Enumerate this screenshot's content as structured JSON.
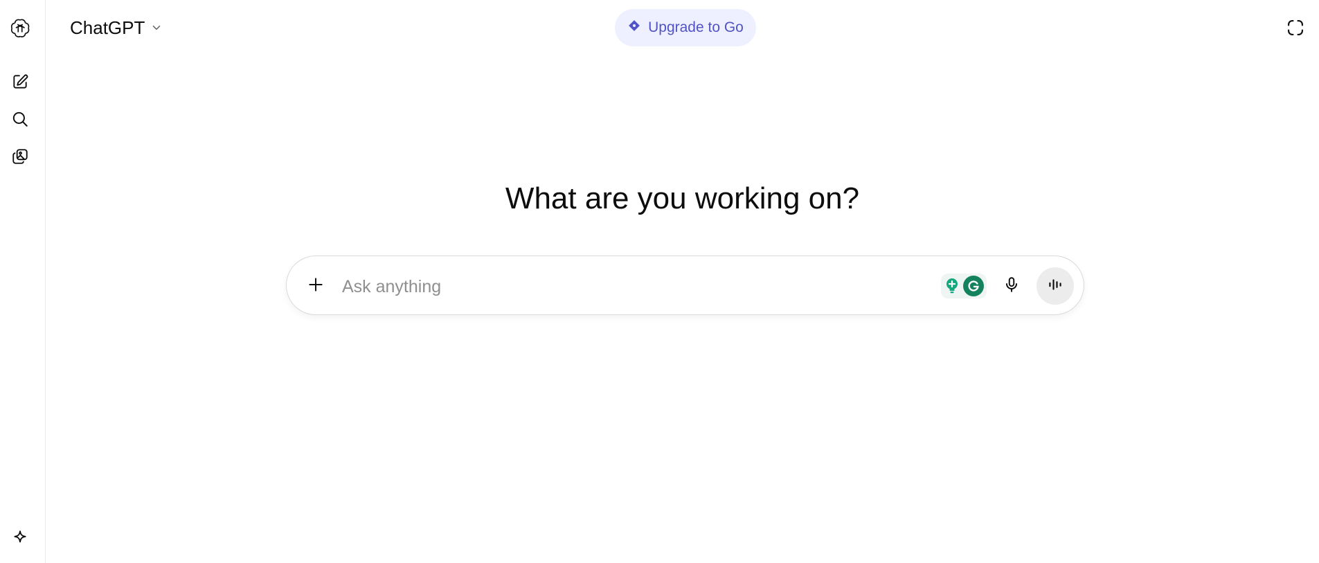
{
  "header": {
    "model_name": "ChatGPT",
    "upgrade_label": "Upgrade to Go"
  },
  "sidebar": {
    "items": [
      {
        "icon": "openai-logo-icon"
      },
      {
        "icon": "new-chat-icon"
      },
      {
        "icon": "search-icon"
      },
      {
        "icon": "library-icon"
      },
      {
        "icon": "sparkle-icon"
      }
    ]
  },
  "main": {
    "title": "What are you working on?"
  },
  "composer": {
    "placeholder": "Ask anything"
  },
  "colors": {
    "accent": "#5154c6",
    "upgrade_bg": "#eeefff",
    "grammarly": "#15825e"
  }
}
